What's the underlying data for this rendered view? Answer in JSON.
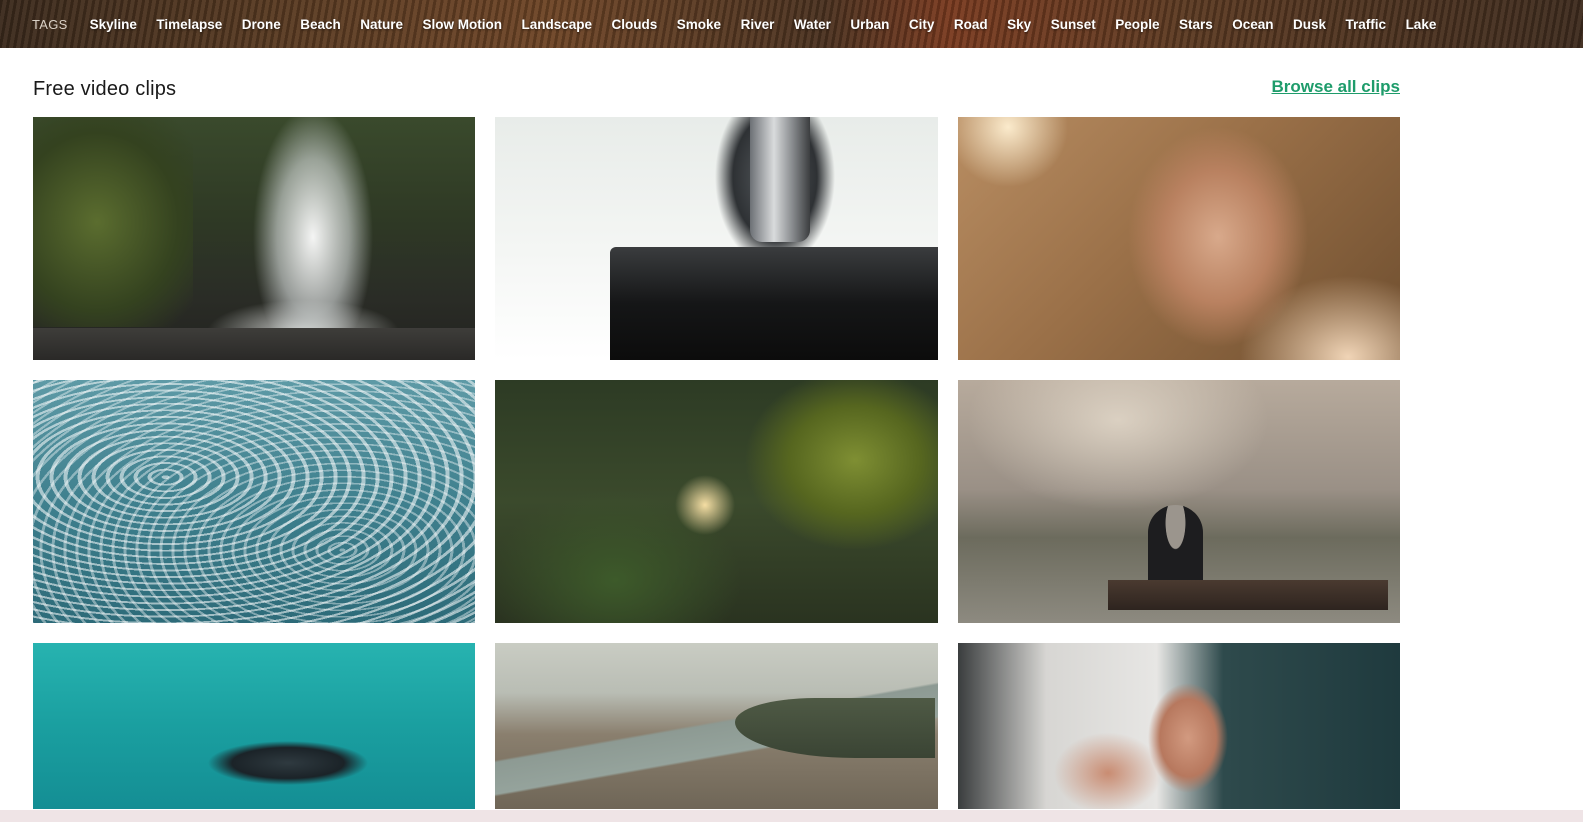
{
  "tags": {
    "label": "TAGS",
    "items": [
      "Skyline",
      "Timelapse",
      "Drone",
      "Beach",
      "Nature",
      "Slow Motion",
      "Landscape",
      "Clouds",
      "Smoke",
      "River",
      "Water",
      "Urban",
      "City",
      "Road",
      "Sky",
      "Sunset",
      "People",
      "Stars",
      "Ocean",
      "Dusk",
      "Traffic",
      "Lake"
    ]
  },
  "section": {
    "title": "Free video clips",
    "browse_label": "Browse all clips"
  },
  "clips": [
    {
      "icon": "waterfall-thumbnail"
    },
    {
      "icon": "microscope-thumbnail"
    },
    {
      "icon": "baby-hands-thumbnail"
    },
    {
      "icon": "ocean-waves-thumbnail"
    },
    {
      "icon": "sunlit-leaf-thumbnail"
    },
    {
      "icon": "park-bench-thumbnail"
    },
    {
      "icon": "whale-aerial-thumbnail"
    },
    {
      "icon": "city-river-aerial-thumbnail"
    },
    {
      "icon": "fist-bump-thumbnail"
    }
  ],
  "colors": {
    "link": "#1e9c6b",
    "title": "#1a1a1a"
  }
}
